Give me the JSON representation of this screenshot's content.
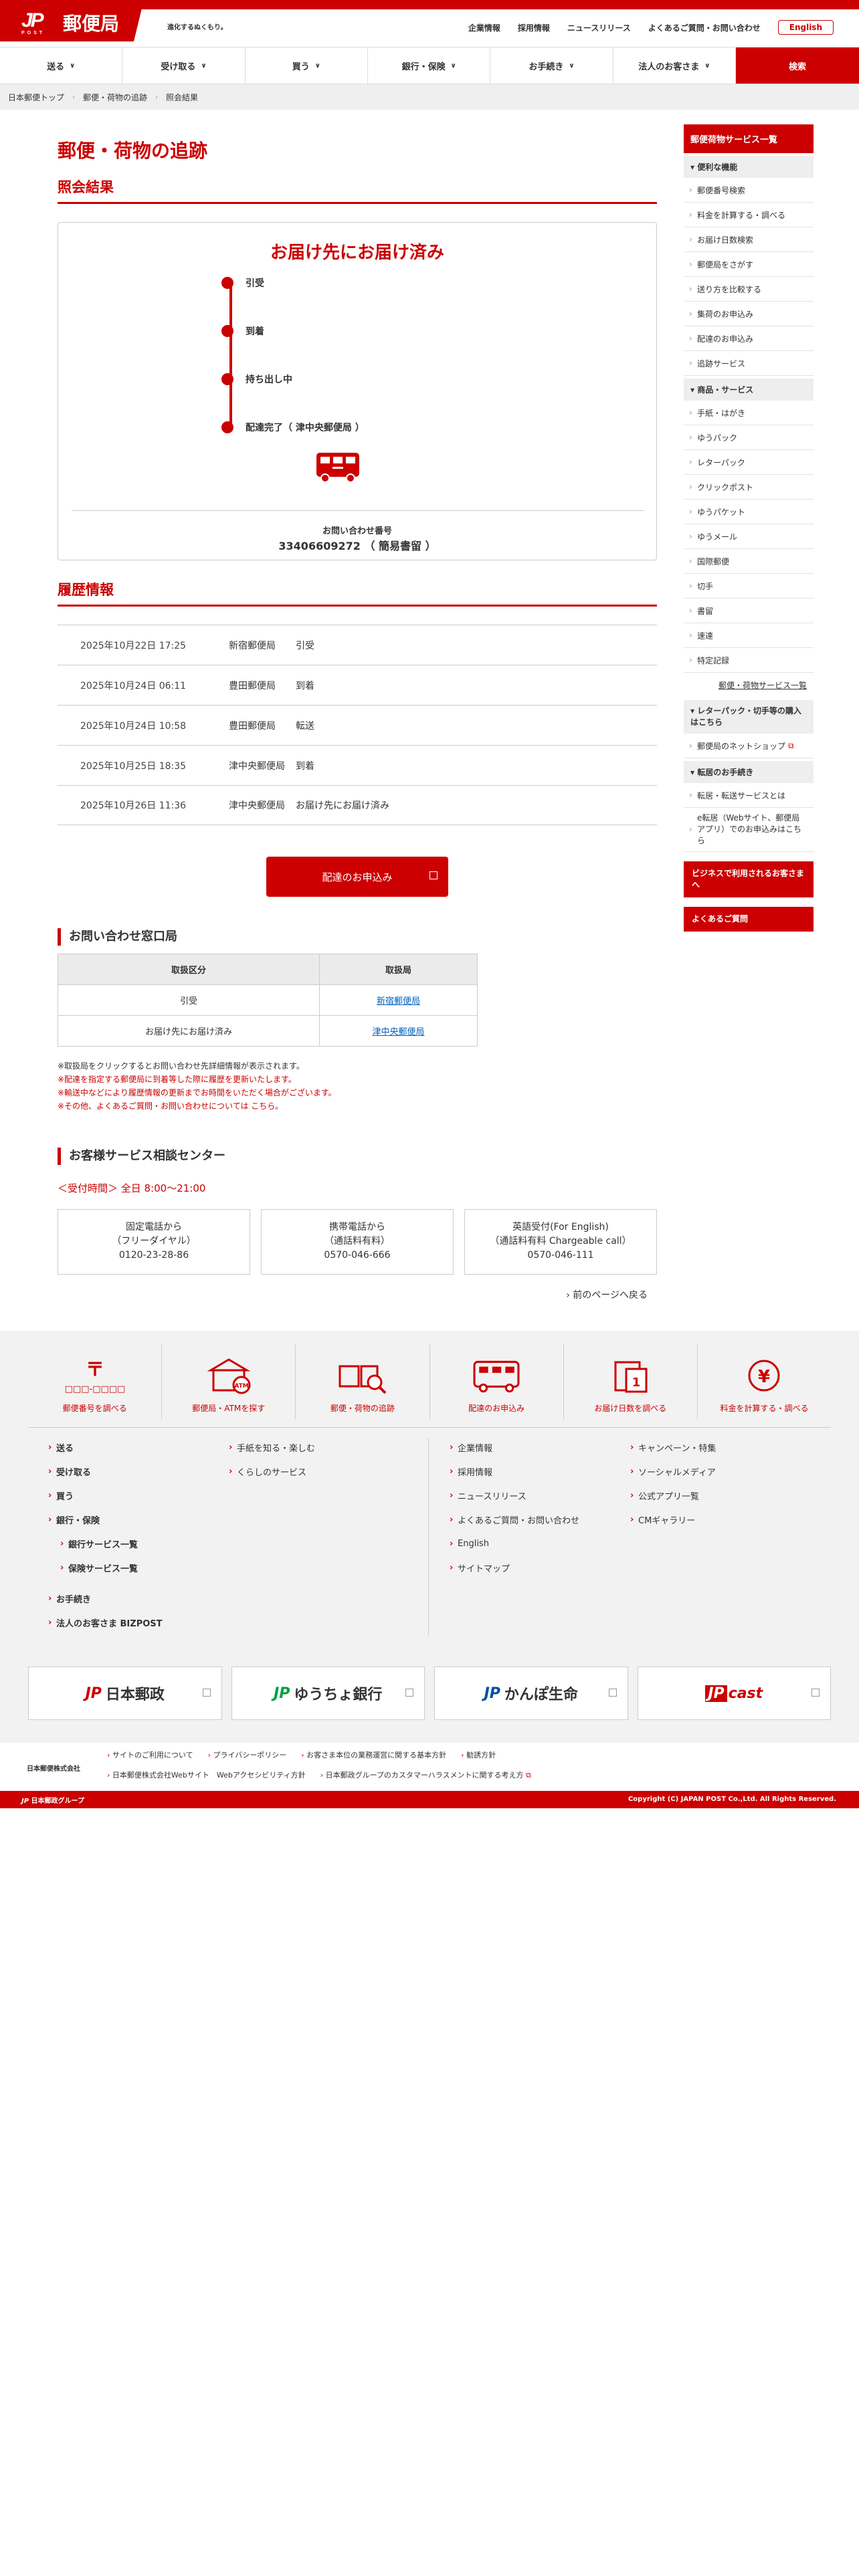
{
  "header": {
    "logo_mark": "JP",
    "logo_post": "POST",
    "logo_name": "郵便局",
    "tagline": "進化するぬくもり。",
    "util_links": [
      "企業情報",
      "採用情報",
      "ニュースリリース",
      "よくあるご質問・お問い合わせ"
    ],
    "english_label": "English"
  },
  "gnav": {
    "items": [
      "送る",
      "受け取る",
      "買う",
      "銀行・保険",
      "お手続き",
      "法人のお客さま"
    ],
    "search_label": "検索"
  },
  "breadcrumb": [
    "日本郵便トップ",
    "郵便・荷物の追跡",
    "照会結果"
  ],
  "page_title": "郵便・荷物の追跡",
  "result": {
    "section_title": "照会結果",
    "status_head": "お届け先にお届け済み",
    "steps": [
      "引受",
      "到着",
      "持ち出し中",
      "配達完了（ 津中央郵便局 ）"
    ],
    "inquiry_label": "お問い合わせ番号",
    "inquiry_number": "33406609272 （ 簡易書留 ）"
  },
  "history": {
    "section_title": "履歴情報",
    "rows": [
      {
        "date": "2025年10月22日 17:25",
        "office": "新宿郵便局",
        "status": "引受"
      },
      {
        "date": "2025年10月24日 06:11",
        "office": "豊田郵便局",
        "status": "到着"
      },
      {
        "date": "2025年10月24日 10:58",
        "office": "豊田郵便局",
        "status": "転送"
      },
      {
        "date": "2025年10月25日 18:35",
        "office": "津中央郵便局",
        "status": "到着"
      },
      {
        "date": "2025年10月26日 11:36",
        "office": "津中央郵便局",
        "status": "お届け先にお届け済み"
      }
    ]
  },
  "cta_label": "配達のお申込み",
  "contact_office": {
    "title": "お問い合わせ窓口局",
    "headers": [
      "取扱区分",
      "取扱局"
    ],
    "rows": [
      {
        "category": "引受",
        "office": "新宿郵便局"
      },
      {
        "category": "お届け先にお届け済み",
        "office": "津中央郵便局"
      }
    ]
  },
  "notes": [
    "※取扱局をクリックするとお問い合わせ先詳細情報が表示されます。",
    "※配達を指定する郵便局に到着等した際に履歴を更新いたします。",
    "※輸送中などにより履歴情報の更新までお時間をいただく場合がございます。",
    "※その他、よくあるご質問・お問い合わせについては こちら。"
  ],
  "call_center": {
    "title": "お客様サービス相談センター",
    "hours": "＜受付時間＞ 全日 8:00〜21:00",
    "boxes": [
      {
        "line1": "固定電話から",
        "line2": "（フリーダイヤル）",
        "number": "0120-23-28-86"
      },
      {
        "line1": "携帯電話から",
        "line2": "（通話料有料）",
        "number": "0570-046-666"
      },
      {
        "line1": "英語受付(For English)",
        "line2": "（通話料有料 Chargeable call）",
        "number": "0570-046-111"
      }
    ],
    "back_label": "前のページへ戻る"
  },
  "sidebar": {
    "head": "郵便荷物サービス一覧",
    "groups": [
      {
        "title": "便利な機能",
        "links": [
          "郵便番号検索",
          "料金を計算する・調べる",
          "お届け日数検索",
          "郵便局をさがす",
          "送り方を比較する",
          "集荷のお申込み",
          "配達のお申込み",
          "追跡サービス"
        ]
      },
      {
        "title": "商品・サービス",
        "links": [
          "手紙・はがき",
          "ゆうパック",
          "レターパック",
          "クリックポスト",
          "ゆうパケット",
          "ゆうメール",
          "国際郵便",
          "切手",
          "書留",
          "速達",
          "特定記録"
        ]
      }
    ],
    "more_label": "郵便・荷物サービス一覧",
    "group3_title": "レターパック・切手等の購入はこちら",
    "group3_link": "郵便局のネットショップ",
    "group4_title": "転居のお手続き",
    "group4_links": [
      "転居・転送サービスとは",
      "e転居（Webサイト、郵便局アプリ）でのお申込みはこちら"
    ],
    "btn_business": "ビジネスで利用されるお客さまへ",
    "btn_faq": "よくあるご質問"
  },
  "footer": {
    "services": [
      "郵便番号を調べる",
      "郵便局・ATMを探す",
      "郵便・荷物の追跡",
      "配達のお申込み",
      "お届け日数を調べる",
      "料金を計算する・調べる"
    ],
    "postcode_glyph": "〒",
    "postcode_boxes": "□□□-□□□□",
    "atm_label": "ATM",
    "calendar_day": "1",
    "yen_glyph": "¥",
    "col1": [
      "送る",
      "受け取る",
      "買う",
      "銀行・保険"
    ],
    "col1_sub": [
      "銀行サービス一覧",
      "保険サービス一覧"
    ],
    "col1_tail": [
      "お手続き",
      "法人のお客さま BIZPOST"
    ],
    "col2": [
      "手紙を知る・楽しむ",
      "くらしのサービス"
    ],
    "col3": [
      "企業情報",
      "採用情報",
      "ニュースリリース",
      "よくあるご質問・お問い合わせ",
      "English",
      "サイトマップ"
    ],
    "col4": [
      "キャンペーン・特集",
      "ソーシャルメディア",
      "公式アプリ一覧",
      "CMギャラリー"
    ],
    "brands": [
      "日本郵政",
      "ゆうちょ銀行",
      "かんぽ生命",
      "cast"
    ],
    "brand_logo_text": "JP",
    "company": "日本郵便株式会社",
    "legal_links": [
      "サイトのご利用について",
      "プライバシーポリシー",
      "お客さま本位の業務運営に関する基本方針",
      "勧誘方針",
      "日本郵便株式会社Webサイト　Webアクセシビリティ方針",
      "日本郵政グループのカスタマーハラスメントに関する考え方"
    ],
    "group_label": "日本郵政グループ",
    "copyright": "Copyright (C) JAPAN POST Co.,Ltd.  All Rights Reserved."
  },
  "colors": {
    "brand_red": "#cc0000",
    "link_blue": "#0060c0",
    "table_header": "#ebebeb"
  }
}
